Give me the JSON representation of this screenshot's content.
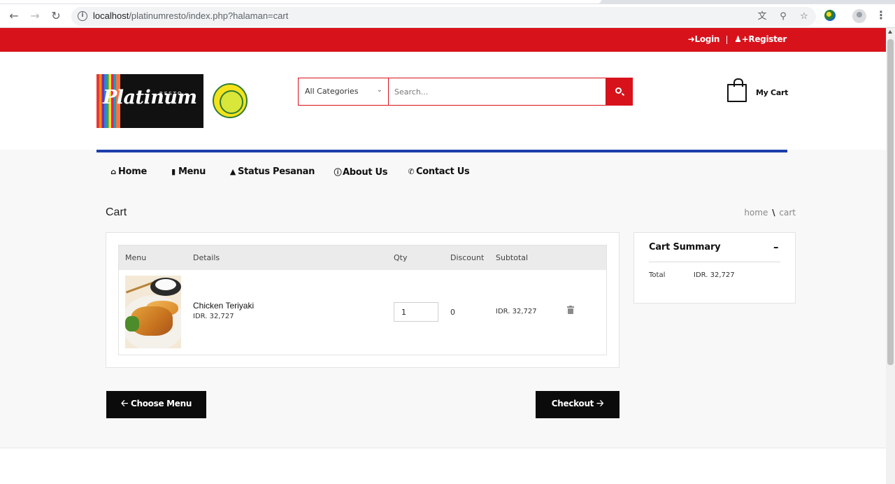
{
  "browser": {
    "url_host": "localhost",
    "url_path": "/platinumresto/index.php?halaman=cart"
  },
  "topbar": {
    "login": "Login",
    "register": "Register"
  },
  "header": {
    "logo_text": "Platinum",
    "logo_sub": "RESTO",
    "search": {
      "category": "All Categories",
      "placeholder": "Search..."
    },
    "cart_label": "My Cart"
  },
  "nav": {
    "home": "Home",
    "menu": "Menu",
    "status": "Status Pesanan",
    "about": "About Us",
    "contact": "Contact Us"
  },
  "page": {
    "title": "Cart",
    "breadcrumb_home": "home",
    "breadcrumb_sep": "\\",
    "breadcrumb_current": "cart"
  },
  "cart_table": {
    "headers": {
      "menu": "Menu",
      "details": "Details",
      "qty": "Qty",
      "discount": "Discount",
      "subtotal": "Subtotal"
    },
    "rows": [
      {
        "name": "Chicken Teriyaki",
        "price": "IDR. 32,727",
        "qty": "1",
        "discount": "0",
        "subtotal": "IDR. 32,727"
      }
    ]
  },
  "summary": {
    "title": "Cart Summary",
    "collapse": "–",
    "total_label": "Total",
    "total_value": "IDR. 32,727"
  },
  "actions": {
    "choose_menu": "Choose Menu",
    "checkout": "Checkout"
  },
  "colors": {
    "brand_red": "#d8121b",
    "nav_blue": "#1c3faa",
    "button_black": "#0b0b0b"
  }
}
